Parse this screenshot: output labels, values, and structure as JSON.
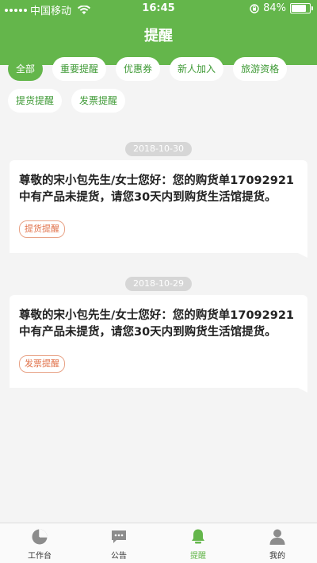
{
  "status": {
    "carrier": "中国移动",
    "time": "16:45",
    "battery_percent": "84%",
    "battery_level": 0.84
  },
  "header": {
    "title": "提醒"
  },
  "filters": [
    {
      "label": "全部",
      "active": true
    },
    {
      "label": "重要提醒",
      "active": false
    },
    {
      "label": "优惠券",
      "active": false
    },
    {
      "label": "新人加入",
      "active": false
    },
    {
      "label": "旅游资格",
      "active": false
    },
    {
      "label": "提货提醒",
      "active": false
    },
    {
      "label": "发票提醒",
      "active": false
    }
  ],
  "messages": [
    {
      "date": "2018-10-30",
      "text": "尊敬的宋小包先生/女士您好：您的购货单17092921中有产品未提货，请您30天内到购货生活馆提货。",
      "tag": "提货提醒"
    },
    {
      "date": "2018-10-29",
      "text": "尊敬的宋小包先生/女士您好：您的购货单17092921中有产品未提货，请您30天内到购货生活馆提货。",
      "tag": "发票提醒"
    }
  ],
  "tabbar": {
    "items": [
      {
        "label": "工作台",
        "icon": "pie-chart-icon"
      },
      {
        "label": "公告",
        "icon": "chat-bubble-icon"
      },
      {
        "label": "提醒",
        "icon": "bell-icon",
        "active": true
      },
      {
        "label": "我的",
        "icon": "person-icon"
      }
    ]
  },
  "colors": {
    "accent": "#64b64b",
    "tag": "#e07048"
  }
}
